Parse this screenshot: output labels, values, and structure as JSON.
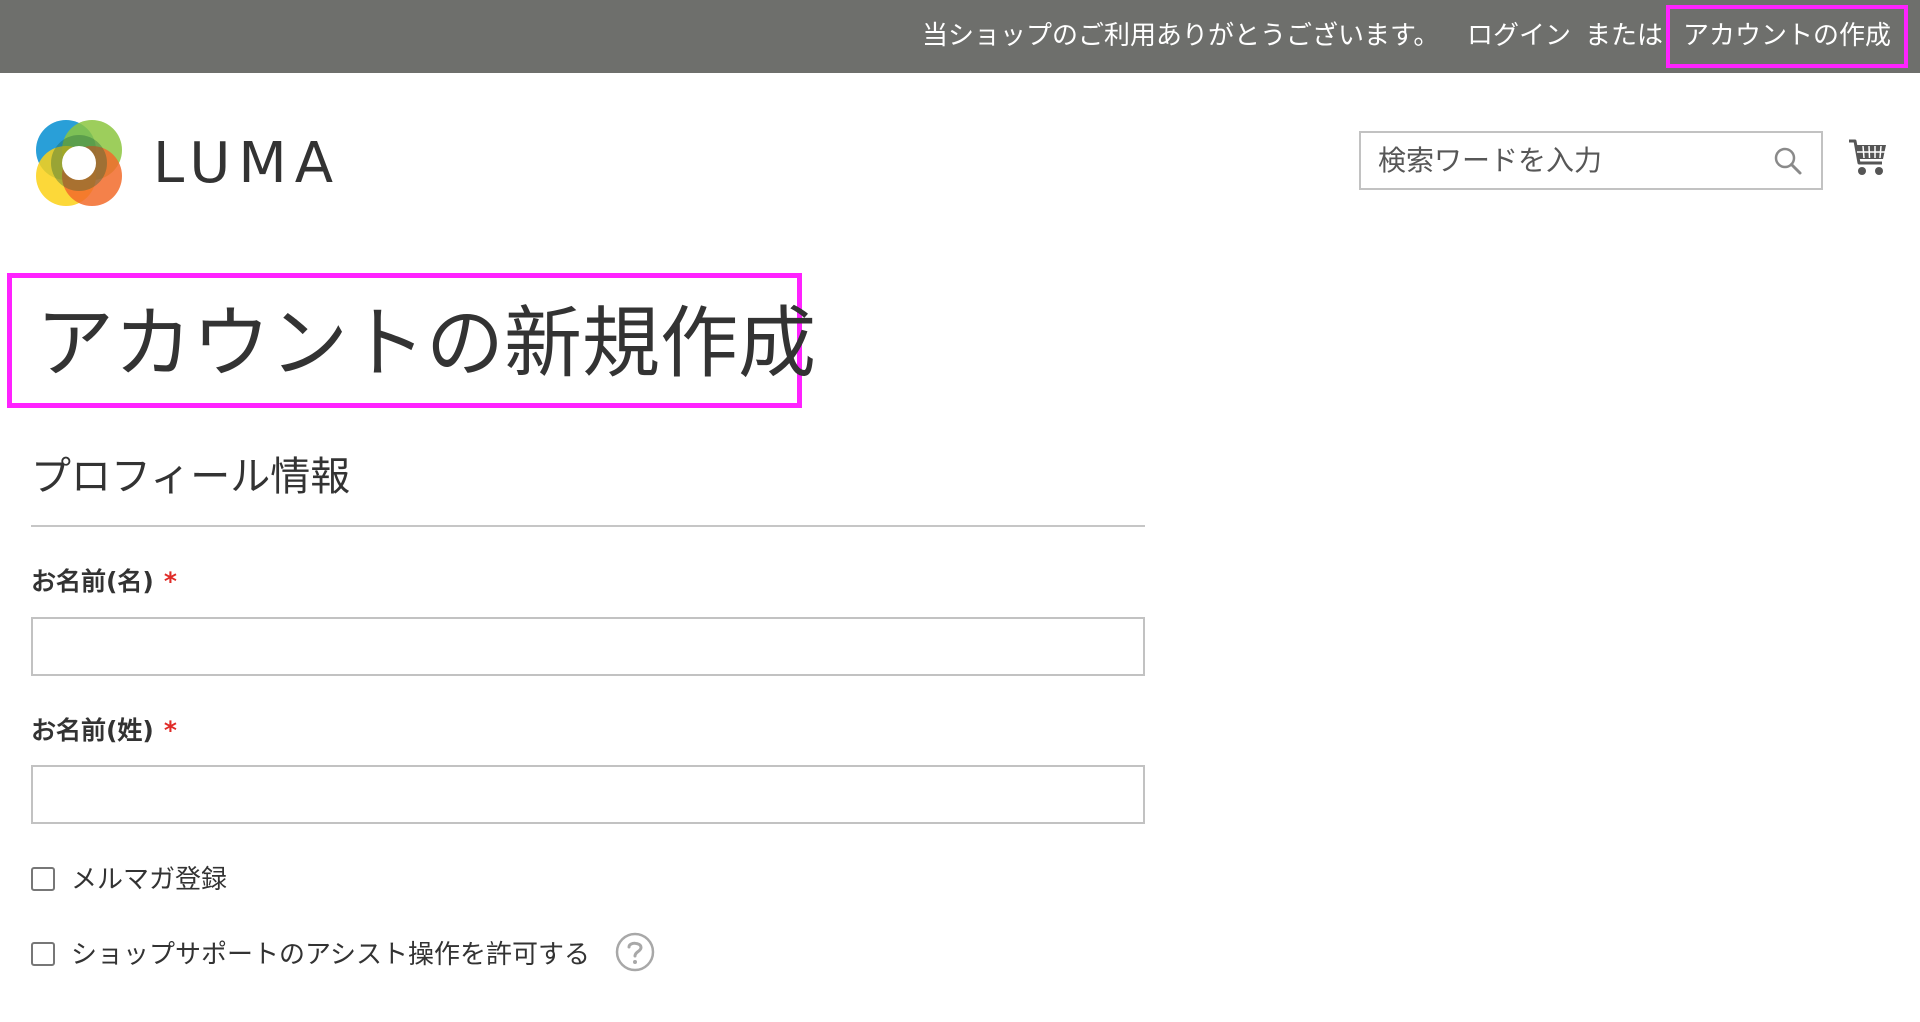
{
  "header": {
    "welcome": "当ショップのご利用ありがとうございます。",
    "login": "ログイン",
    "or": "または",
    "create_account": "アカウントの作成"
  },
  "logo": {
    "text": "LUMA",
    "icon": "luma-logo-icon"
  },
  "search": {
    "placeholder": "検索ワードを入力",
    "value": "",
    "icon": "search-icon"
  },
  "cart": {
    "icon": "cart-icon"
  },
  "page": {
    "title": "アカウントの新規作成"
  },
  "profile": {
    "section_title": "プロフィール情報",
    "first_name": {
      "label": "お名前(名)",
      "required_mark": "*",
      "value": ""
    },
    "last_name": {
      "label": "お名前(姓)",
      "required_mark": "*",
      "value": ""
    },
    "newsletter": {
      "label": "メルマガ登録",
      "checked": false
    },
    "assistance": {
      "label": "ショップサポートのアシスト操作を許可する",
      "checked": false,
      "help_icon": "question-mark-icon"
    }
  },
  "colors": {
    "topbar_bg": "#6e6f6c",
    "highlight": "#ff22ff",
    "required": "#e02b27"
  }
}
